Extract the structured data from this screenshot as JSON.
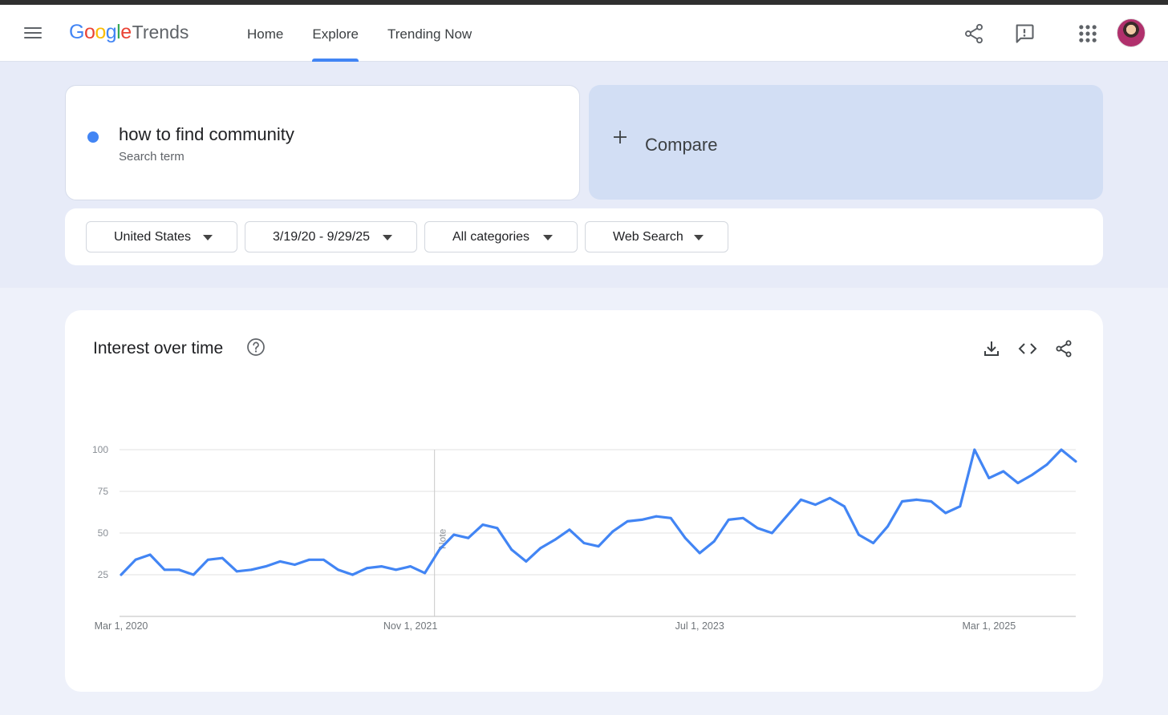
{
  "header": {
    "logo": {
      "google": [
        "G",
        "o",
        "o",
        "g",
        "l",
        "e"
      ],
      "google_colors": [
        "#4285f4",
        "#ea4335",
        "#fbbc05",
        "#4285f4",
        "#34a853",
        "#ea4335"
      ],
      "product": "Trends"
    },
    "nav": [
      {
        "label": "Home",
        "active": false
      },
      {
        "label": "Explore",
        "active": true
      },
      {
        "label": "Trending Now",
        "active": false
      }
    ],
    "icons": [
      "menu-icon",
      "share-icon",
      "feedback-icon",
      "apps-grid-icon",
      "avatar"
    ]
  },
  "search": {
    "term": "how to find community",
    "term_type": "Search term",
    "term_color": "#4285f4",
    "compare_label": "Compare"
  },
  "filters": [
    {
      "label": "United States"
    },
    {
      "label": "3/19/20 - 9/29/25"
    },
    {
      "label": "All categories"
    },
    {
      "label": "Web Search"
    }
  ],
  "chart_card": {
    "title": "Interest over time",
    "icons": [
      "help-icon",
      "download-icon",
      "embed-icon",
      "share-icon"
    ]
  },
  "chart_data": {
    "type": "line",
    "x_start": "2020-03-01",
    "x_end": "2025-09-01",
    "x_step": "month",
    "x_ticks": [
      "Mar 1, 2020",
      "Nov 1, 2021",
      "Jul 1, 2023",
      "Mar 1, 2025"
    ],
    "y_ticks": [
      25,
      50,
      75,
      100
    ],
    "ylim": [
      0,
      100
    ],
    "annotation": {
      "label": "Note",
      "at": "2022-01-01"
    },
    "series": [
      {
        "color": "#4285f4",
        "values": [
          25,
          34,
          37,
          28,
          28,
          25,
          34,
          35,
          27,
          28,
          30,
          33,
          31,
          34,
          34,
          28,
          25,
          29,
          30,
          28,
          30,
          26,
          40,
          49,
          47,
          55,
          53,
          40,
          33,
          41,
          46,
          52,
          44,
          42,
          51,
          57,
          58,
          60,
          59,
          47,
          38,
          45,
          58,
          59,
          53,
          50,
          60,
          70,
          67,
          71,
          66,
          49,
          44,
          54,
          69,
          70,
          69,
          62,
          66,
          100,
          83,
          87,
          80,
          85,
          91,
          100,
          93
        ]
      }
    ]
  }
}
